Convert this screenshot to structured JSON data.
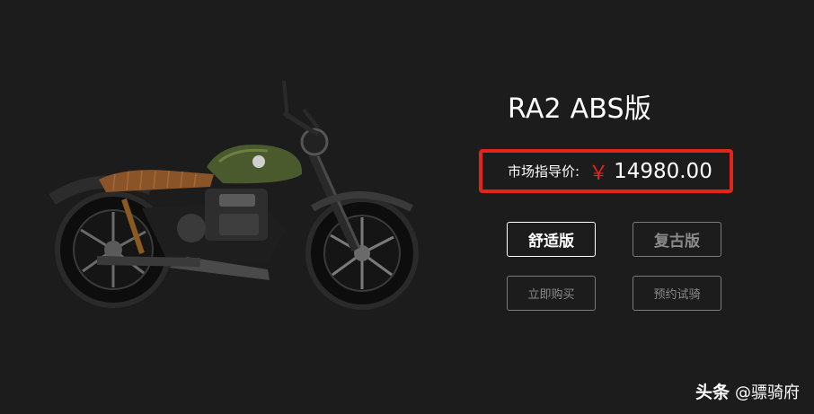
{
  "product": {
    "title": "RA2 ABS版",
    "image_alt_icon": "motorcycle-image"
  },
  "price": {
    "label": "市场指导价:",
    "currency": "￥",
    "value": "14980.00",
    "highlight_color": "#e2241c"
  },
  "variants": {
    "comfort_label": "舒适版",
    "retro_label": "复古版",
    "selected": "舒适版"
  },
  "actions": {
    "buy_label": "立即购买",
    "test_ride_label": "预约试骑"
  },
  "watermark": {
    "brand": "头条",
    "handle": "@骠骑府"
  },
  "colors": {
    "background": "#1c1c1c",
    "text": "#ffffff",
    "muted": "#8a8a8a",
    "tank_green": "#4a5a2c",
    "seat_brown": "#8a5328"
  }
}
